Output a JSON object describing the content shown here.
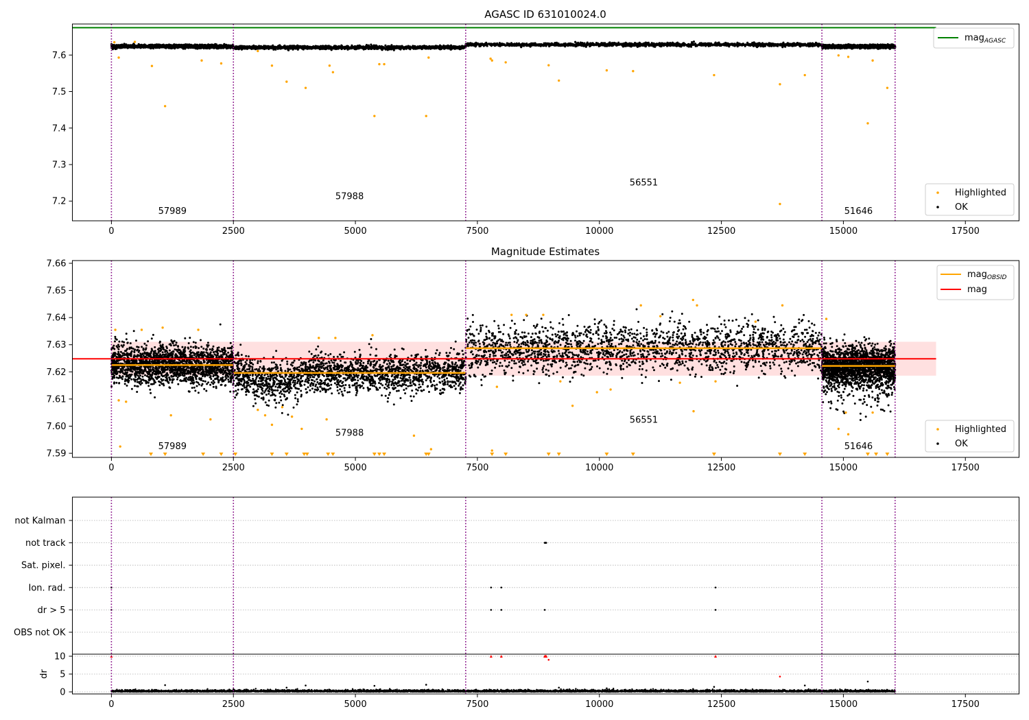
{
  "colors": {
    "ok": "#000000",
    "highlighted": "#ffa500",
    "mag_agasc": "#008000",
    "mag": "#ff0000",
    "mag_obsid": "#ffa500",
    "band": "#ffd6d6",
    "obs_line": "#800080",
    "grid": "#b0b0b0"
  },
  "obs_boundaries": [
    0,
    2500,
    7260,
    14560,
    16060
  ],
  "obs_labels": [
    "57989",
    "57988",
    "56551",
    "51646"
  ],
  "chart_data": [
    {
      "type": "scatter",
      "title": "AGASC ID 631010024.0",
      "xlabel": "",
      "ylabel": "",
      "xlim": [
        -800,
        18600
      ],
      "ylim": [
        7.146,
        7.685
      ],
      "xticks": [
        0,
        2500,
        5000,
        7500,
        10000,
        12500,
        15000,
        17500
      ],
      "yticks": [
        7.2,
        7.3,
        7.4,
        7.5,
        7.6
      ],
      "ytick_labels": [
        "7.2",
        "7.3",
        "7.4",
        "7.5",
        "7.6"
      ],
      "grid": false,
      "legend_top": {
        "placement": "upper right",
        "entries": [
          {
            "label": "mag",
            "sub": "AGASC",
            "kind": "line",
            "color": "#008000"
          }
        ]
      },
      "legend_bottom": {
        "placement": "lower right",
        "entries": [
          {
            "label": "Highlighted",
            "kind": "dot",
            "color": "#ffa500"
          },
          {
            "label": "OK",
            "kind": "dot",
            "color": "#000000"
          }
        ]
      },
      "mag_agasc": 7.675,
      "segments": [
        {
          "x": [
            0,
            2500
          ],
          "mean": 7.6237,
          "spread": 0.004,
          "label": "57989",
          "label_y": 7.165
        },
        {
          "x": [
            2500,
            7260
          ],
          "mean": 7.6207,
          "spread": 0.004,
          "label": "57988",
          "label_y": 7.205
        },
        {
          "x": [
            7260,
            14560
          ],
          "mean": 7.6285,
          "spread": 0.004,
          "label": "56551",
          "label_y": 7.243
        },
        {
          "x": [
            14560,
            16060
          ],
          "mean": 7.6233,
          "spread": 0.004,
          "label": "51646",
          "label_y": 7.165
        }
      ],
      "highlighted_outliers": [
        {
          "x": 60,
          "y": 7.635
        },
        {
          "x": 150,
          "y": 7.593
        },
        {
          "x": 480,
          "y": 7.636
        },
        {
          "x": 830,
          "y": 7.57
        },
        {
          "x": 1100,
          "y": 7.46
        },
        {
          "x": 1850,
          "y": 7.585
        },
        {
          "x": 2250,
          "y": 7.577
        },
        {
          "x": 3000,
          "y": 7.611
        },
        {
          "x": 3290,
          "y": 7.571
        },
        {
          "x": 3590,
          "y": 7.527
        },
        {
          "x": 3980,
          "y": 7.51
        },
        {
          "x": 4470,
          "y": 7.571
        },
        {
          "x": 4540,
          "y": 7.553
        },
        {
          "x": 5390,
          "y": 7.433
        },
        {
          "x": 5490,
          "y": 7.575
        },
        {
          "x": 5590,
          "y": 7.575
        },
        {
          "x": 6450,
          "y": 7.433
        },
        {
          "x": 6500,
          "y": 7.593
        },
        {
          "x": 7770,
          "y": 7.59
        },
        {
          "x": 7800,
          "y": 7.585
        },
        {
          "x": 8080,
          "y": 7.58
        },
        {
          "x": 8960,
          "y": 7.572
        },
        {
          "x": 9170,
          "y": 7.53
        },
        {
          "x": 10150,
          "y": 7.558
        },
        {
          "x": 10690,
          "y": 7.556
        },
        {
          "x": 12350,
          "y": 7.545
        },
        {
          "x": 13700,
          "y": 7.52
        },
        {
          "x": 13700,
          "y": 7.192
        },
        {
          "x": 14210,
          "y": 7.545
        },
        {
          "x": 14900,
          "y": 7.599
        },
        {
          "x": 15100,
          "y": 7.595
        },
        {
          "x": 15500,
          "y": 7.413
        },
        {
          "x": 15600,
          "y": 7.585
        },
        {
          "x": 15900,
          "y": 7.51
        }
      ]
    },
    {
      "type": "scatter",
      "title": "Magnitude Estimates",
      "xlabel": "",
      "ylabel": "",
      "xlim": [
        -800,
        18600
      ],
      "ylim": [
        7.5885,
        7.661
      ],
      "xticks": [
        0,
        2500,
        5000,
        7500,
        10000,
        12500,
        15000,
        17500
      ],
      "yticks": [
        7.59,
        7.6,
        7.61,
        7.62,
        7.63,
        7.64,
        7.65,
        7.66
      ],
      "ytick_labels": [
        "7.59",
        "7.60",
        "7.61",
        "7.62",
        "7.63",
        "7.64",
        "7.65",
        "7.66"
      ],
      "grid": false,
      "legend_top": {
        "placement": "upper right",
        "entries": [
          {
            "label": "mag",
            "sub": "OBSID",
            "kind": "line",
            "color": "#ffa500"
          },
          {
            "label": "mag",
            "kind": "line",
            "color": "#ff0000"
          }
        ]
      },
      "legend_bottom": {
        "placement": "lower right",
        "entries": [
          {
            "label": "Highlighted",
            "kind": "dot",
            "color": "#ffa500"
          },
          {
            "label": "OK",
            "kind": "dot",
            "color": "#000000"
          }
        ]
      },
      "mag": 7.6248,
      "mag_band": [
        7.6186,
        7.6311
      ],
      "mag_extent": [
        0,
        16900
      ],
      "segments": [
        {
          "x": [
            0,
            2500
          ],
          "mean": 7.6225,
          "spread": 0.0035,
          "label": "57989",
          "label_y": 7.5915
        },
        {
          "x": [
            2500,
            7260
          ],
          "mean": 7.6196,
          "spread": 0.0035,
          "label": "57988",
          "label_y": 7.5965
        },
        {
          "x": [
            7260,
            14560
          ],
          "mean": 7.6287,
          "spread": 0.0045,
          "label": "56551",
          "label_y": 7.6012
        },
        {
          "x": [
            14560,
            16060
          ],
          "mean": 7.6222,
          "spread": 0.0035,
          "label": "51646",
          "label_y": 7.5915
        }
      ],
      "highlighted_outliers": [
        {
          "x": 80,
          "y": 7.6355
        },
        {
          "x": 150,
          "y": 7.6095
        },
        {
          "x": 180,
          "y": 7.5925
        },
        {
          "x": 300,
          "y": 7.609
        },
        {
          "x": 620,
          "y": 7.6355
        },
        {
          "x": 1050,
          "y": 7.6363
        },
        {
          "x": 1220,
          "y": 7.604
        },
        {
          "x": 1780,
          "y": 7.6355
        },
        {
          "x": 2030,
          "y": 7.6025
        },
        {
          "x": 3000,
          "y": 7.606
        },
        {
          "x": 3150,
          "y": 7.604
        },
        {
          "x": 3290,
          "y": 7.6005
        },
        {
          "x": 3500,
          "y": 7.607
        },
        {
          "x": 3700,
          "y": 7.6035
        },
        {
          "x": 3900,
          "y": 7.599
        },
        {
          "x": 4250,
          "y": 7.6325
        },
        {
          "x": 4410,
          "y": 7.6025
        },
        {
          "x": 4590,
          "y": 7.6325
        },
        {
          "x": 5350,
          "y": 7.6335
        },
        {
          "x": 6200,
          "y": 7.5965
        },
        {
          "x": 6550,
          "y": 7.5915
        },
        {
          "x": 7800,
          "y": 7.591
        },
        {
          "x": 7900,
          "y": 7.6145
        },
        {
          "x": 8200,
          "y": 7.641
        },
        {
          "x": 8500,
          "y": 7.641
        },
        {
          "x": 8850,
          "y": 7.641
        },
        {
          "x": 9200,
          "y": 7.6165
        },
        {
          "x": 9450,
          "y": 7.6075
        },
        {
          "x": 9950,
          "y": 7.6125
        },
        {
          "x": 10230,
          "y": 7.6135
        },
        {
          "x": 10850,
          "y": 7.6445
        },
        {
          "x": 11250,
          "y": 7.6405
        },
        {
          "x": 11650,
          "y": 7.616
        },
        {
          "x": 11920,
          "y": 7.6465
        },
        {
          "x": 11930,
          "y": 7.6055
        },
        {
          "x": 12000,
          "y": 7.6445
        },
        {
          "x": 12380,
          "y": 7.6165
        },
        {
          "x": 13200,
          "y": 7.6385
        },
        {
          "x": 13750,
          "y": 7.6445
        },
        {
          "x": 14650,
          "y": 7.6395
        },
        {
          "x": 14900,
          "y": 7.599
        },
        {
          "x": 15050,
          "y": 7.605
        },
        {
          "x": 15100,
          "y": 7.597
        },
        {
          "x": 15600,
          "y": 7.605
        }
      ],
      "clipped_below_x": [
        810,
        1100,
        1880,
        2250,
        2540,
        3290,
        3590,
        3950,
        4010,
        4440,
        4540,
        5390,
        5490,
        5590,
        6450,
        6500,
        7800,
        8080,
        8960,
        9170,
        10150,
        10690,
        12350,
        13700,
        14210,
        15500,
        15670,
        15900
      ]
    },
    {
      "type": "scatter",
      "title": "",
      "xlabel": "",
      "ylabel": "",
      "xlim": [
        -800,
        18600
      ],
      "xticks": [
        0,
        2500,
        5000,
        7500,
        10000,
        12500,
        15000,
        17500
      ],
      "flags": [
        "not Kalman",
        "not track",
        "Sat. pixel.",
        "Ion. rad.",
        "dr > 5",
        "OBS not OK"
      ],
      "flag_points": [
        {
          "flag": "not track",
          "x": [
            8880,
            8890,
            8900,
            8910
          ]
        },
        {
          "flag": "Ion. rad.",
          "x": [
            0,
            7780,
            7990,
            12380
          ]
        },
        {
          "flag": "dr > 5",
          "x": [
            0,
            7780,
            7990,
            8880,
            12380
          ]
        }
      ],
      "dr": {
        "ylabel": "dr",
        "ylim": [
          -0.5,
          10.5
        ],
        "yticks": [
          0,
          5,
          10
        ],
        "ytick_labels": [
          "0",
          "5",
          "10"
        ],
        "clipped_top_x": [
          0,
          7780,
          7990,
          8880,
          8890,
          8900,
          8910,
          12380
        ],
        "outliers": [
          {
            "x": 1100,
            "y": 1.9,
            "color": "#000000"
          },
          {
            "x": 2500,
            "y": 0.6,
            "color": "#000000"
          },
          {
            "x": 3590,
            "y": 1.2,
            "color": "#000000"
          },
          {
            "x": 3980,
            "y": 1.8,
            "color": "#000000"
          },
          {
            "x": 5390,
            "y": 1.7,
            "color": "#000000"
          },
          {
            "x": 6450,
            "y": 2.0,
            "color": "#000000"
          },
          {
            "x": 8960,
            "y": 9.0,
            "color": "#ff0000"
          },
          {
            "x": 9170,
            "y": 1.2,
            "color": "#000000"
          },
          {
            "x": 10150,
            "y": 1.0,
            "color": "#000000"
          },
          {
            "x": 11920,
            "y": 0.8,
            "color": "#000000"
          },
          {
            "x": 12350,
            "y": 1.4,
            "color": "#000000"
          },
          {
            "x": 13700,
            "y": 4.3,
            "color": "#ff0000"
          },
          {
            "x": 14210,
            "y": 1.8,
            "color": "#000000"
          },
          {
            "x": 15500,
            "y": 2.9,
            "color": "#000000"
          }
        ]
      }
    }
  ]
}
